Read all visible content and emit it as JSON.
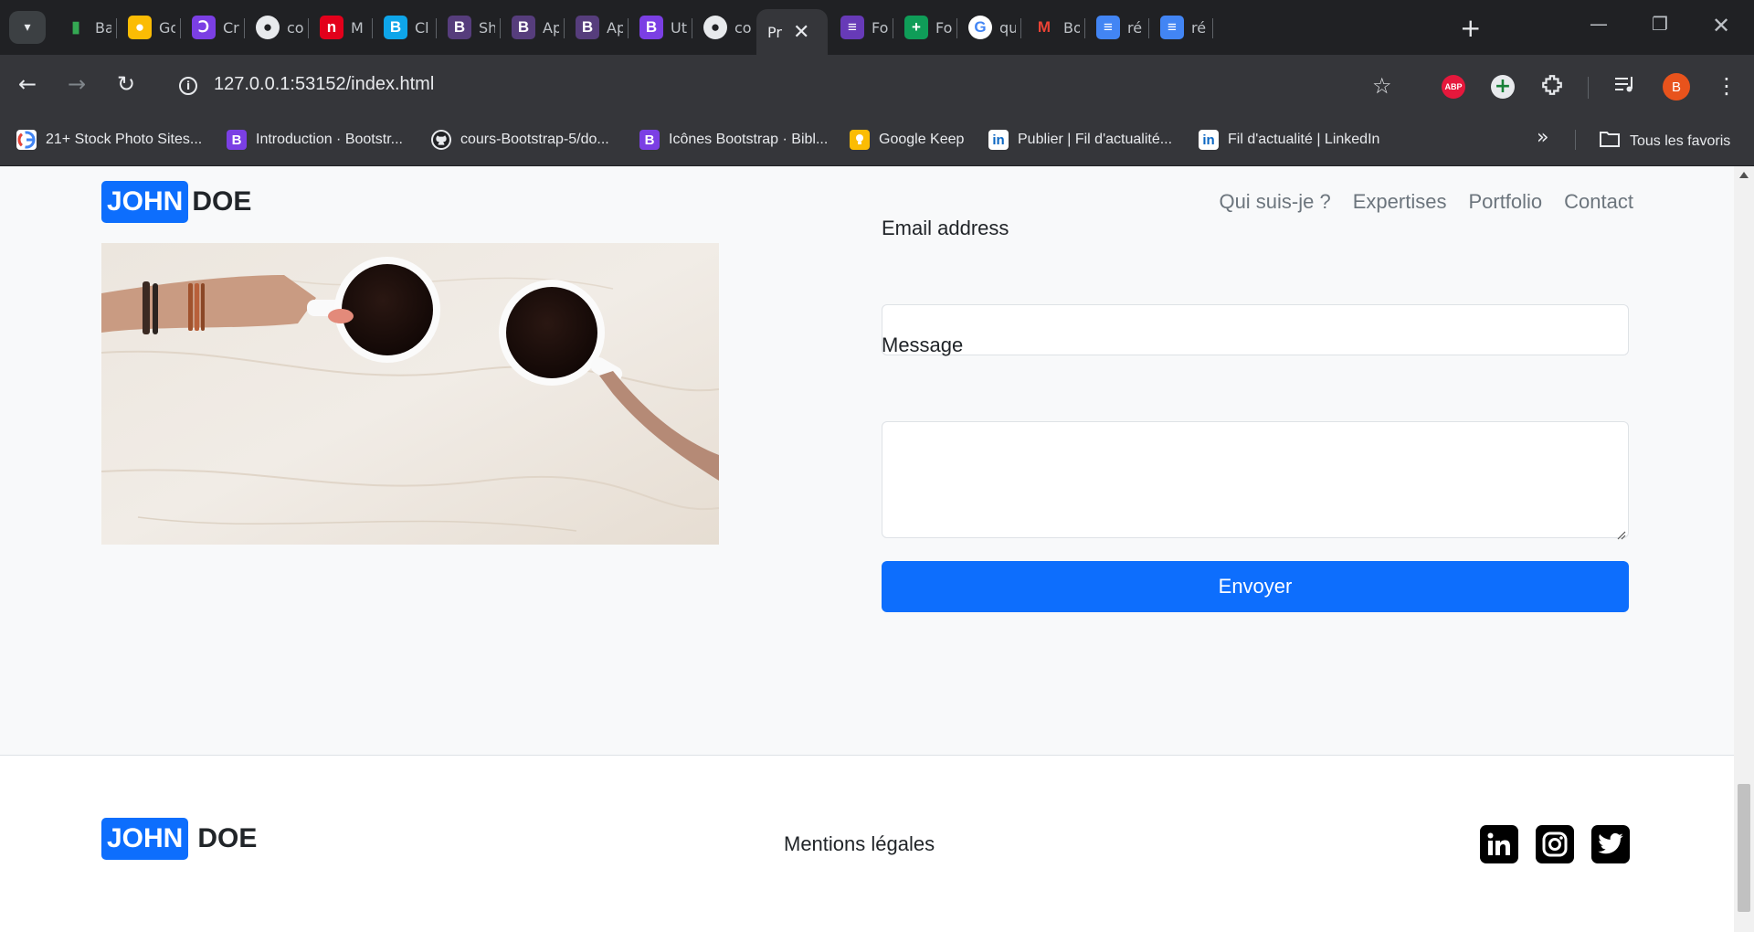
{
  "browser": {
    "tabs": [
      {
        "title": "Ba",
        "icon": "bar-chart-icon",
        "color": "#34a853"
      },
      {
        "title": "Go",
        "icon": "keep-icon",
        "color": "#fbbc04"
      },
      {
        "title": "Cr",
        "icon": "crescent-icon",
        "color": "#7b3fe4"
      },
      {
        "title": "co",
        "icon": "github-icon",
        "color": "#202124"
      },
      {
        "title": "M",
        "icon": "m-logo-icon",
        "color": "#e3001b"
      },
      {
        "title": "Cl",
        "icon": "b-logo-icon",
        "color": "#0ea5e9"
      },
      {
        "title": "Sh",
        "icon": "bootstrap-icon",
        "color": "#563d7c"
      },
      {
        "title": "Ap",
        "icon": "bootstrap-icon",
        "color": "#563d7c"
      },
      {
        "title": "Ap",
        "icon": "bootstrap-icon",
        "color": "#563d7c"
      },
      {
        "title": "Ut",
        "icon": "bootstrap-icon",
        "color": "#7b3fe4"
      },
      {
        "title": "co",
        "icon": "github-icon",
        "color": "#202124"
      },
      {
        "title": "Pr",
        "icon": "",
        "color": "",
        "active": true
      },
      {
        "title": "Fo",
        "icon": "forms-icon",
        "color": "#673ab7"
      },
      {
        "title": "Fo",
        "icon": "sheets-icon",
        "color": "#0f9d58"
      },
      {
        "title": "qu",
        "icon": "google-icon",
        "color": "#ffffff"
      },
      {
        "title": "Bo",
        "icon": "gmail-icon",
        "color": "#ffffff"
      },
      {
        "title": "ré",
        "icon": "docs-icon",
        "color": "#4285f4"
      },
      {
        "title": "ré",
        "icon": "docs-icon",
        "color": "#4285f4"
      }
    ],
    "url": "127.0.0.1:53152/index.html",
    "avatar_letter": "B",
    "abp_label": "ABP",
    "bookmarks": [
      {
        "label": "21+ Stock Photo Sites...",
        "icon": "google-icon"
      },
      {
        "label": "Introduction · Bootstr...",
        "icon": "bootstrap-icon"
      },
      {
        "label": "cours-Bootstrap-5/do...",
        "icon": "github-icon"
      },
      {
        "label": "Icônes Bootstrap · Bibl...",
        "icon": "bootstrap-icon"
      },
      {
        "label": "Google Keep",
        "icon": "keep-icon"
      },
      {
        "label": "Publier | Fil d'actualité...",
        "icon": "linkedin-icon"
      },
      {
        "label": "Fil d'actualité | LinkedIn",
        "icon": "linkedin-icon"
      }
    ],
    "all_bookmarks_label": "Tous les favoris"
  },
  "site": {
    "brand_first": "JOHN",
    "brand_last": "DOE",
    "nav": [
      "Qui suis-je ?",
      "Expertises",
      "Portfolio",
      "Contact"
    ],
    "form": {
      "email_label": "Email address",
      "email_value": "",
      "message_label": "Message",
      "message_value": "",
      "submit_label": "Envoyer"
    },
    "footer": {
      "brand_first": "JOHN",
      "brand_last": "DOE",
      "legal_link": "Mentions légales",
      "social": [
        "linkedin-icon",
        "instagram-icon",
        "twitter-icon"
      ]
    }
  },
  "colors": {
    "primary": "#0d6efd",
    "chrome_dark": "#202124",
    "chrome_mid": "#35363a"
  }
}
